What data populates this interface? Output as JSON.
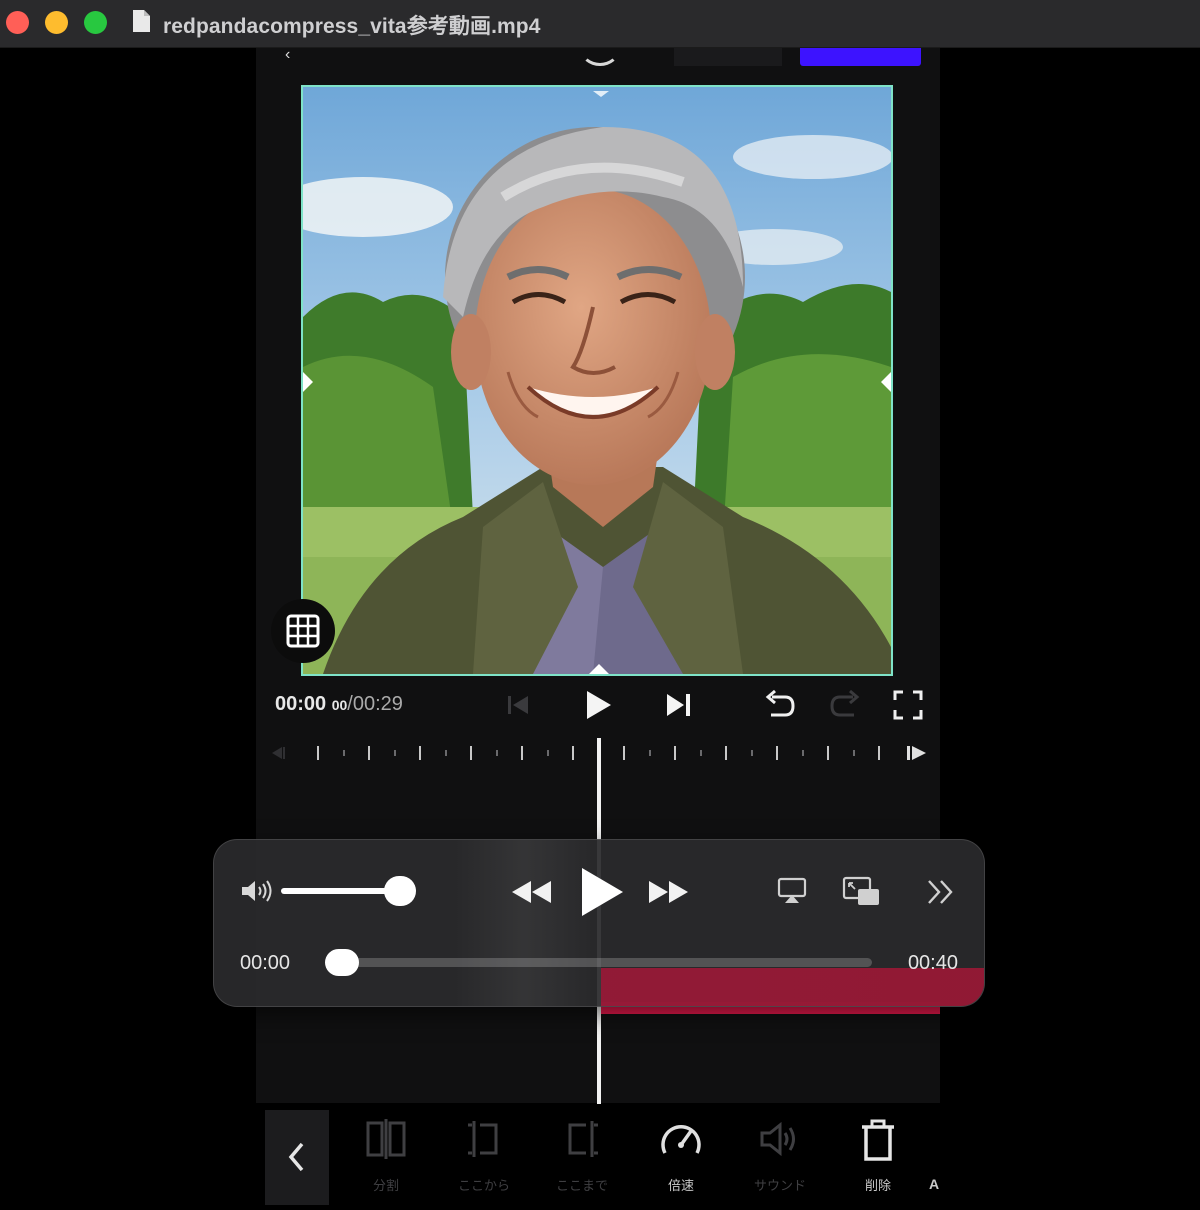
{
  "window": {
    "title": "redpandacompress_vita参考動画.mp4"
  },
  "editor": {
    "current_time": "00:00",
    "current_frames": "00",
    "total_time": "/00:29"
  },
  "player": {
    "elapsed": "00:00",
    "duration": "00:40",
    "volume_level": 0.9,
    "progress": 0.0
  },
  "toolbar": {
    "items": [
      {
        "label": "分割",
        "icon": "split-icon",
        "enabled": false
      },
      {
        "label": "ここから",
        "icon": "trim-start-icon",
        "enabled": false
      },
      {
        "label": "ここまで",
        "icon": "trim-end-icon",
        "enabled": false
      },
      {
        "label": "倍速",
        "icon": "speed-gauge-icon",
        "enabled": true
      },
      {
        "label": "サウンド",
        "icon": "sound-icon",
        "enabled": false
      },
      {
        "label": "削除",
        "icon": "trash-icon",
        "enabled": true
      }
    ],
    "extra": "A"
  },
  "colors": {
    "accent_export": "#3d13ff",
    "crop_border": "#7fe3c8",
    "clip_track": "#e8194c",
    "titlebar": "#2a2a2c"
  }
}
